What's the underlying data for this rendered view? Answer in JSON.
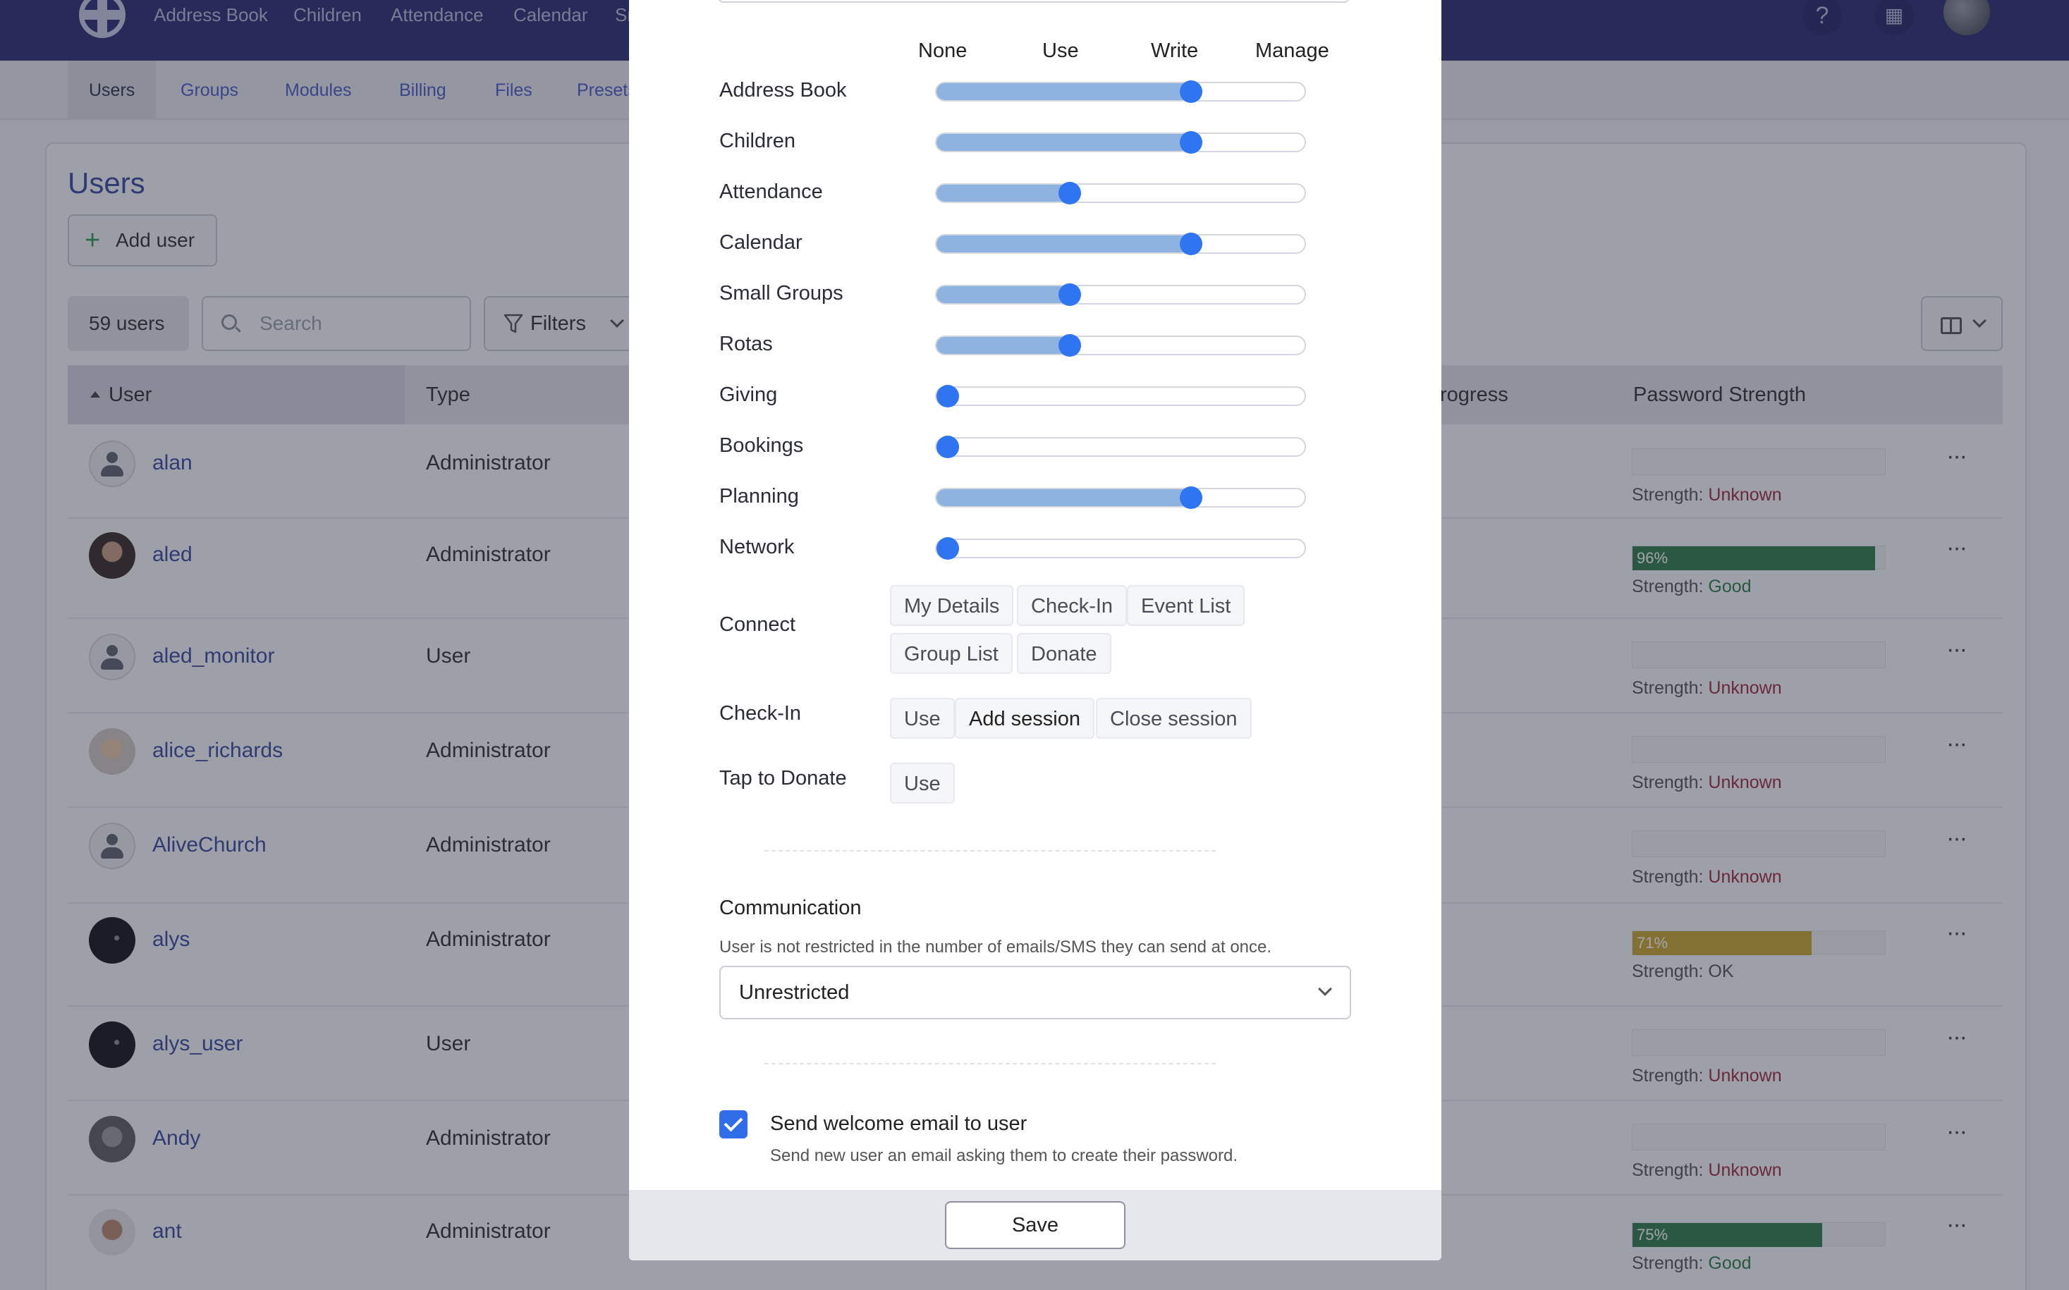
{
  "topnav": {
    "links": [
      "Address Book",
      "Children",
      "Attendance",
      "Calendar",
      "Sr"
    ],
    "help_icon": "help-icon",
    "building_icon": "building-icon"
  },
  "subnav": {
    "tabs": [
      "Users",
      "Groups",
      "Modules",
      "Billing",
      "Files",
      "Presets"
    ],
    "active": "Users"
  },
  "page": {
    "title": "Users",
    "add_user": "Add user",
    "count": "59 users",
    "search_placeholder": "Search",
    "filters": "Filters"
  },
  "table": {
    "headers": {
      "user": "User",
      "type": "Type",
      "progress": "rogress",
      "password": "Password Strength"
    },
    "rows": [
      {
        "name": "alan",
        "type": "Administrator",
        "strength_label": "Strength:",
        "strength": "Unknown",
        "bar": null,
        "bar_color": ""
      },
      {
        "name": "aled",
        "type": "Administrator",
        "strength_label": "Strength:",
        "strength": "Good",
        "bar": "96%",
        "bar_value": 0.96,
        "bar_color": "#2f7d4a"
      },
      {
        "name": "aled_monitor",
        "type": "User",
        "strength_label": "Strength:",
        "strength": "Unknown",
        "bar": null,
        "bar_color": ""
      },
      {
        "name": "alice_richards",
        "type": "Administrator",
        "strength_label": "Strength:",
        "strength": "Unknown",
        "bar": null,
        "bar_color": ""
      },
      {
        "name": "AliveChurch",
        "type": "Administrator",
        "strength_label": "Strength:",
        "strength": "Unknown",
        "bar": null,
        "bar_color": ""
      },
      {
        "name": "alys",
        "type": "Administrator",
        "strength_label": "Strength:",
        "strength": "OK",
        "bar": "71%",
        "bar_value": 0.71,
        "bar_color": "#c9a832"
      },
      {
        "name": "alys_user",
        "type": "User",
        "strength_label": "Strength:",
        "strength": "Unknown",
        "bar": null,
        "bar_color": ""
      },
      {
        "name": "Andy",
        "type": "Administrator",
        "strength_label": "Strength:",
        "strength": "Unknown",
        "bar": null,
        "bar_color": ""
      },
      {
        "name": "ant",
        "type": "Administrator",
        "strength_label": "Strength:",
        "strength": "Good",
        "bar": "75%",
        "bar_value": 0.75,
        "bar_color": "#2f7d4a"
      }
    ]
  },
  "modal": {
    "levels": [
      "None",
      "Use",
      "Write",
      "Manage"
    ],
    "permissions": [
      {
        "label": "Address Book",
        "level": "Write",
        "value": 2
      },
      {
        "label": "Children",
        "level": "Write",
        "value": 2
      },
      {
        "label": "Attendance",
        "level": "Use",
        "value": 1
      },
      {
        "label": "Calendar",
        "level": "Write",
        "value": 2
      },
      {
        "label": "Small Groups",
        "level": "Use",
        "value": 1
      },
      {
        "label": "Rotas",
        "level": "Use",
        "value": 1
      },
      {
        "label": "Giving",
        "level": "None",
        "value": 0
      },
      {
        "label": "Bookings",
        "level": "None",
        "value": 0
      },
      {
        "label": "Planning",
        "level": "Write",
        "value": 2
      },
      {
        "label": "Network",
        "level": "None",
        "value": 0
      }
    ],
    "connect": {
      "label": "Connect",
      "options": [
        "My Details",
        "Check-In",
        "Event List",
        "Group List",
        "Donate"
      ]
    },
    "checkin": {
      "label": "Check-In",
      "options": [
        "Use",
        "Add session",
        "Close session"
      ],
      "selected": "Add session"
    },
    "tap_to_donate": {
      "label": "Tap to Donate",
      "options": [
        "Use"
      ]
    },
    "communication": {
      "title": "Communication",
      "description": "User is not restricted in the number of emails/SMS they can send at once.",
      "value": "Unrestricted"
    },
    "welcome_email": {
      "checked": true,
      "label": "Send welcome email to user",
      "description": "Send new user an email asking them to create their password."
    },
    "save": "Save",
    "accent_color": "#2f74f1"
  }
}
